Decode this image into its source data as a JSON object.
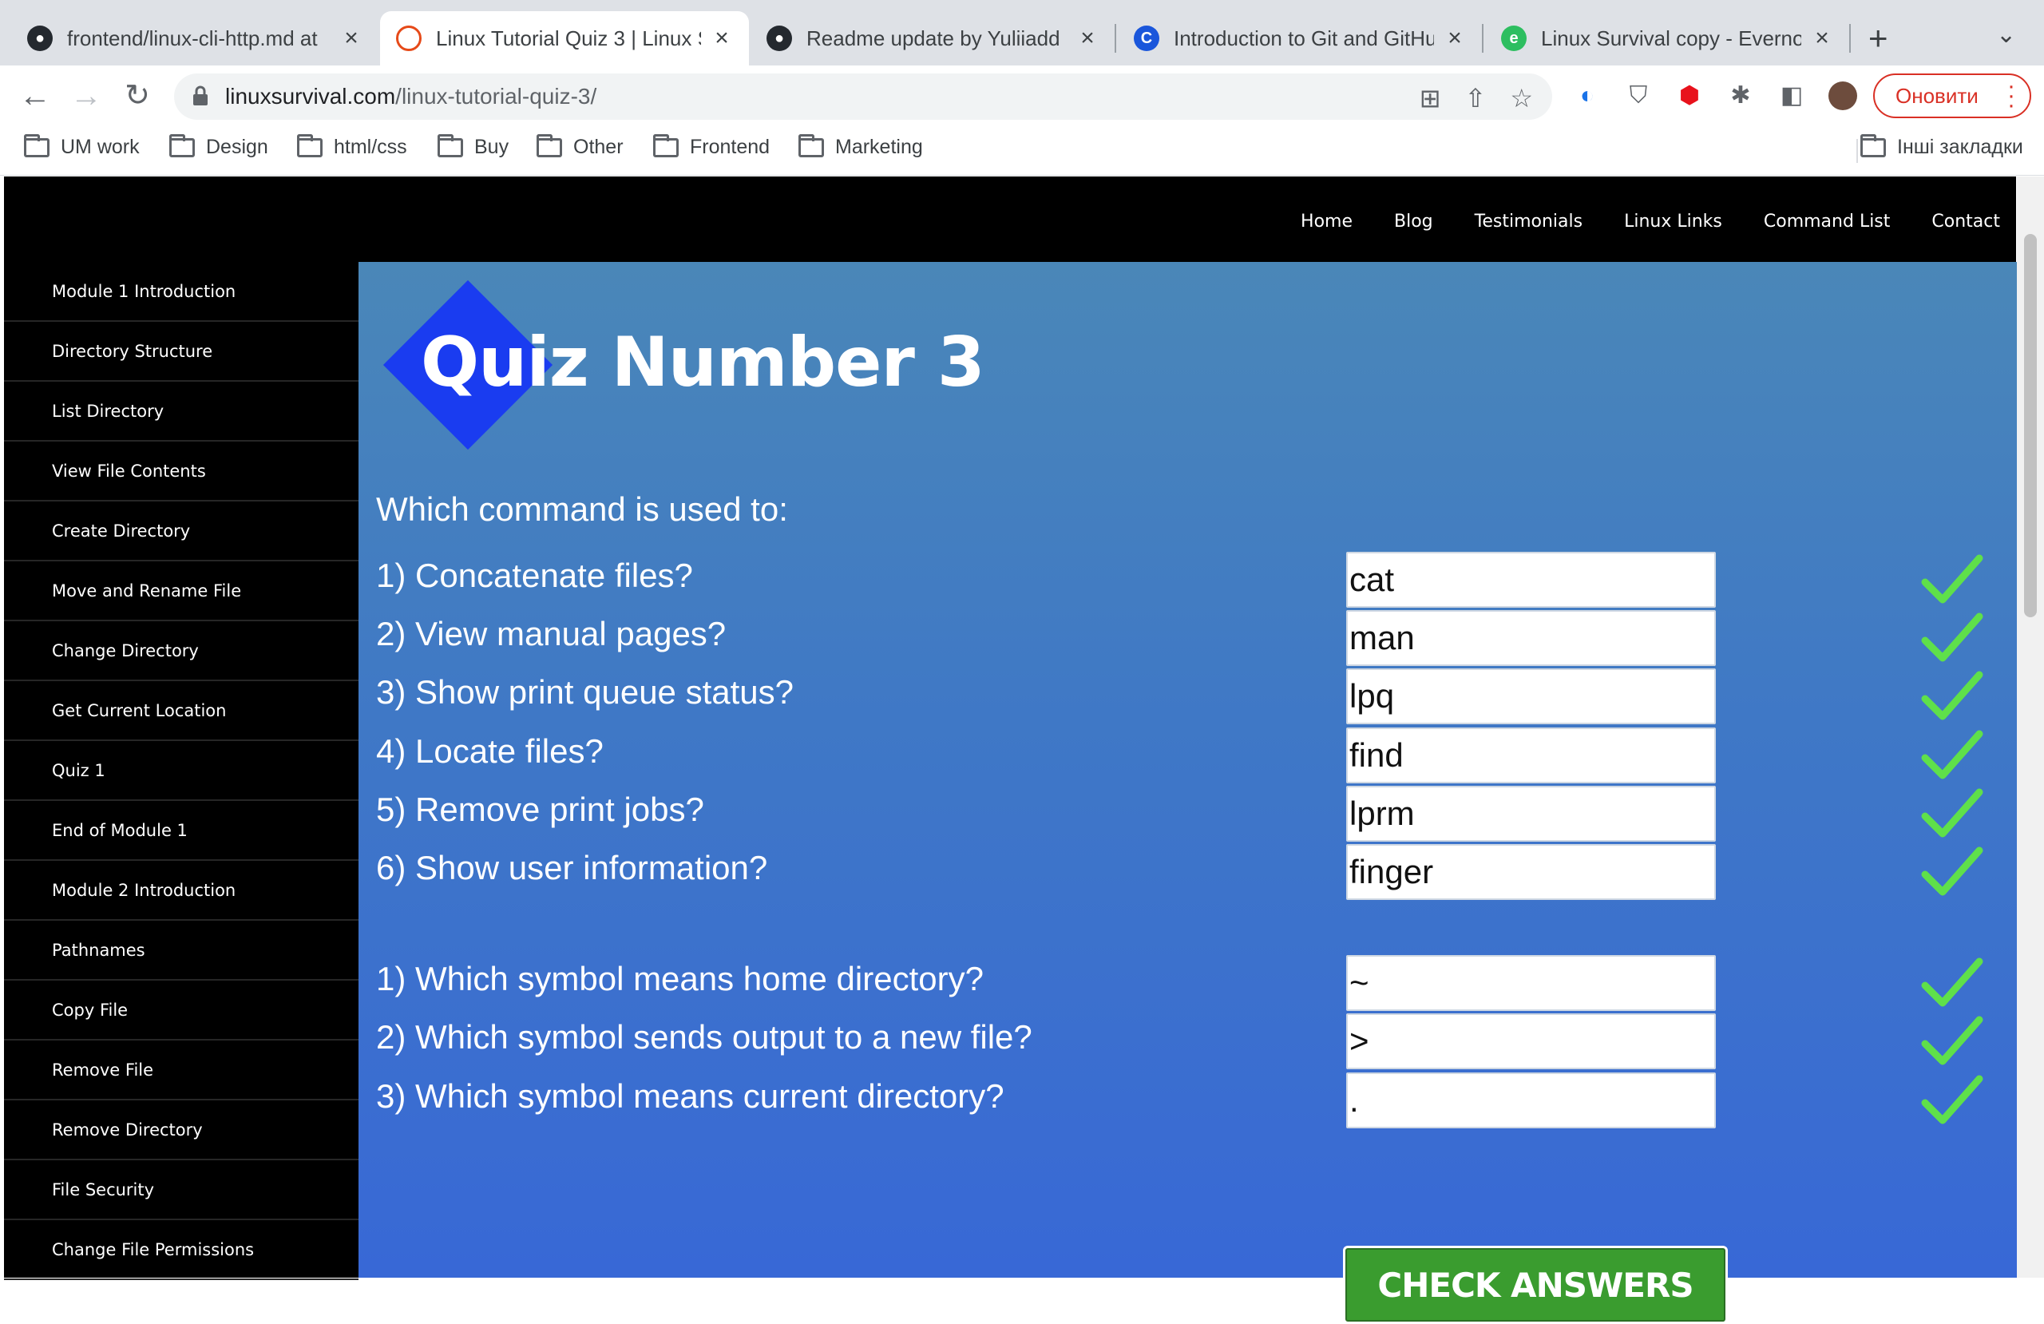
{
  "browser": {
    "tabs": [
      {
        "title": "frontend/linux-cli-http.md at",
        "favicon": "github-icon",
        "active": false
      },
      {
        "title": "Linux Tutorial Quiz 3 | Linux S",
        "favicon": "linuxsurvival-icon",
        "active": true
      },
      {
        "title": "Readme update by Yuliiadd ·",
        "favicon": "github-icon",
        "active": false
      },
      {
        "title": "Introduction to Git and GitHu",
        "favicon": "coursera-icon",
        "active": false
      },
      {
        "title": "Linux Survival copy - Evernot",
        "favicon": "evernote-icon",
        "active": false
      }
    ],
    "url_host": "linuxsurvival.com",
    "url_path": "/linux-tutorial-quiz-3/",
    "update_label": "Оновити",
    "bookmarks": [
      "UM work",
      "Design",
      "html/css",
      "Buy",
      "Other",
      "Frontend",
      "Marketing"
    ],
    "other_bookmarks": "Інші закладки"
  },
  "site": {
    "nav": [
      "Home",
      "Blog",
      "Testimonials",
      "Linux Links",
      "Command List",
      "Contact"
    ],
    "sidebar": [
      "Module 1 Introduction",
      "Directory Structure",
      "List Directory",
      "View File Contents",
      "Create Directory",
      "Move and Rename File",
      "Change Directory",
      "Get Current Location",
      "Quiz 1",
      "End of Module 1",
      "Module 2 Introduction",
      "Pathnames",
      "Copy File",
      "Remove File",
      "Remove Directory",
      "File Security",
      "Change File Permissions"
    ],
    "title": "Quiz Number 3",
    "intro": "Which command is used to:",
    "questions": [
      {
        "text": "1) Concatenate files?",
        "answer": "cat",
        "correct": true
      },
      {
        "text": "2) View manual pages?",
        "answer": "man",
        "correct": true
      },
      {
        "text": "3) Show print queue status?",
        "answer": "lpq",
        "correct": true
      },
      {
        "text": "4) Locate files?",
        "answer": "find",
        "correct": true
      },
      {
        "text": "5) Remove print jobs?",
        "answer": "lprm",
        "correct": true
      },
      {
        "text": "6) Show user information?",
        "answer": "finger",
        "correct": true
      },
      {
        "text": "1) Which symbol means home directory?",
        "answer": "~",
        "correct": true
      },
      {
        "text": "2) Which symbol sends output to a new file?",
        "answer": ">",
        "correct": true
      },
      {
        "text": "3) Which symbol means current directory?",
        "answer": ".",
        "correct": true
      }
    ],
    "check_button": "CHECK ANSWERS"
  },
  "colors": {
    "check_mark": "#5fe04a",
    "button_green": "#3a9c2f",
    "logo_diamond": "#1a3cf0"
  }
}
